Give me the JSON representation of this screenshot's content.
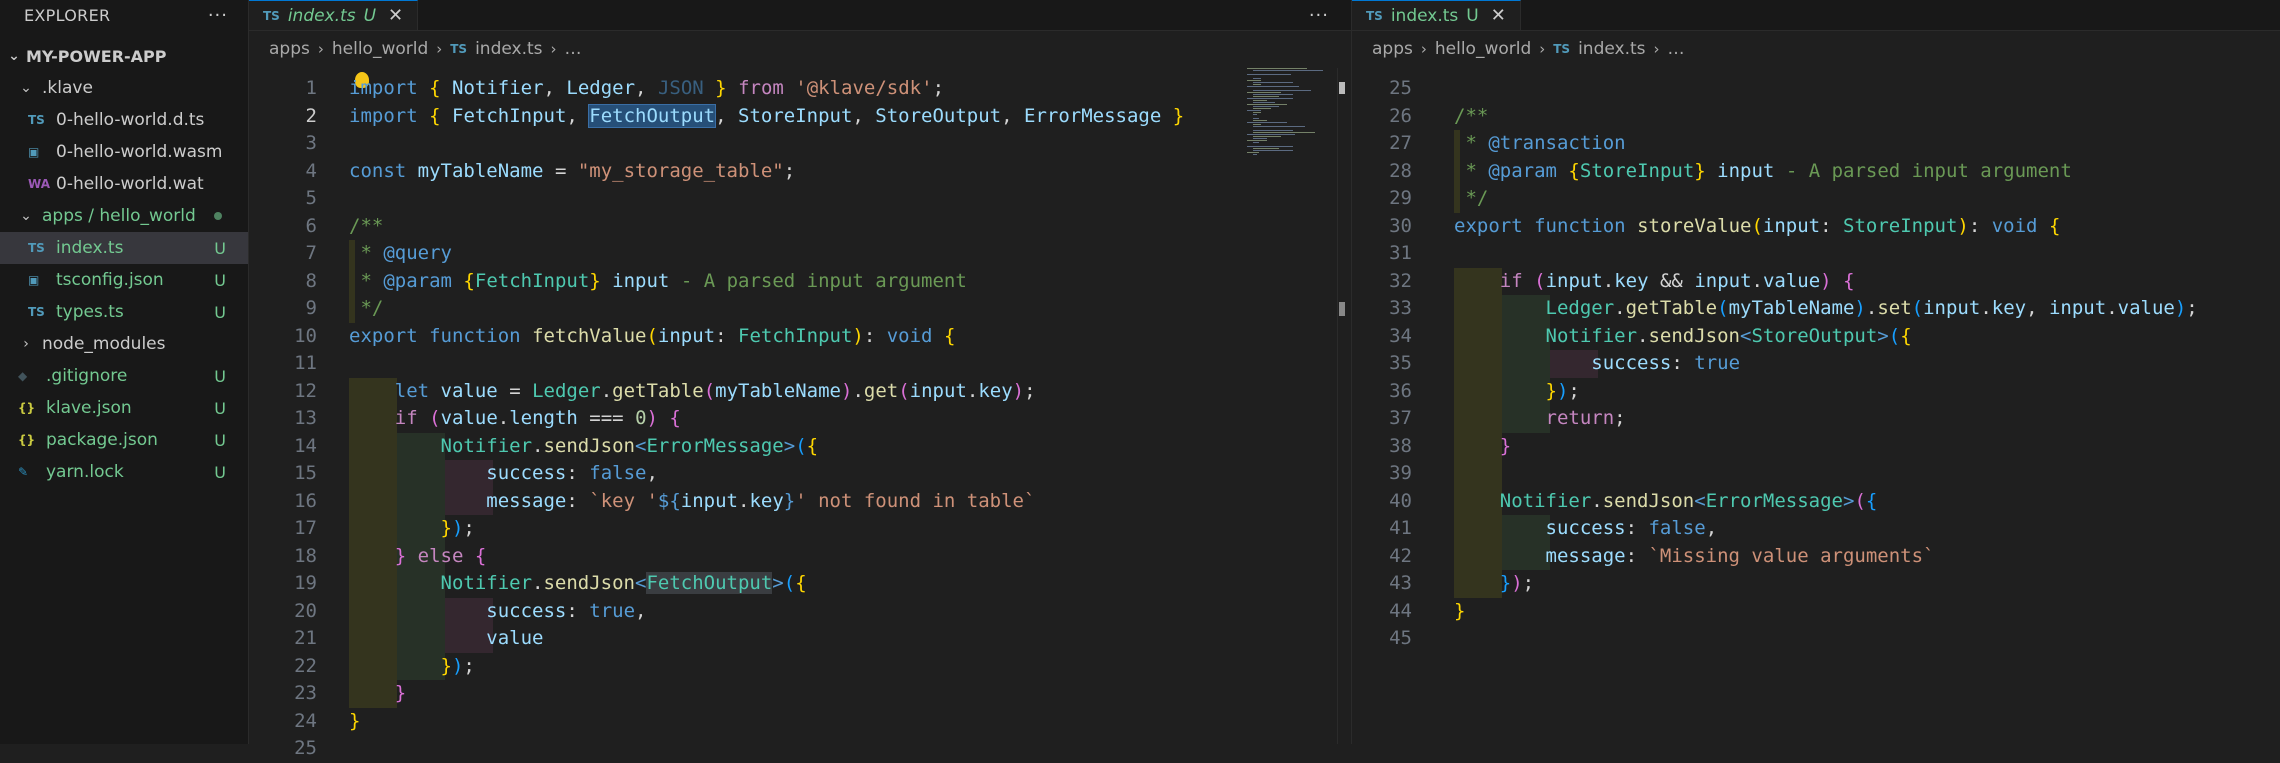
{
  "explorer": {
    "title": "EXPLORER",
    "more": "···",
    "root": "MY-POWER-APP",
    "items": [
      {
        "label": ".klave",
        "type": "folder",
        "indent": 1,
        "open": true,
        "icon": "",
        "status": ""
      },
      {
        "label": "0-hello-world.d.ts",
        "type": "file",
        "indent": 2,
        "icon": "TS",
        "status": ""
      },
      {
        "label": "0-hello-world.wasm",
        "type": "file",
        "indent": 2,
        "icon": "▣",
        "status": ""
      },
      {
        "label": "0-hello-world.wat",
        "type": "file",
        "indent": 2,
        "icon": "WA",
        "status": ""
      },
      {
        "label": "apps / hello_world",
        "type": "folder",
        "indent": 1,
        "open": true,
        "icon": "",
        "status": "dot"
      },
      {
        "label": "index.ts",
        "type": "file",
        "indent": 2,
        "icon": "TS",
        "status": "U",
        "active": true
      },
      {
        "label": "tsconfig.json",
        "type": "file",
        "indent": 2,
        "icon": "▣",
        "status": "U"
      },
      {
        "label": "types.ts",
        "type": "file",
        "indent": 2,
        "icon": "TS",
        "status": "U"
      },
      {
        "label": "node_modules",
        "type": "folder",
        "indent": 1,
        "open": false,
        "icon": "",
        "status": ""
      },
      {
        "label": ".gitignore",
        "type": "file",
        "indent": 1,
        "icon": "◆",
        "status": "U"
      },
      {
        "label": "klave.json",
        "type": "file",
        "indent": 1,
        "icon": "{}",
        "status": "U"
      },
      {
        "label": "package.json",
        "type": "file",
        "indent": 1,
        "icon": "{}",
        "status": "U"
      },
      {
        "label": "yarn.lock",
        "type": "file",
        "indent": 1,
        "icon": "✎",
        "status": "U"
      }
    ]
  },
  "left_editor": {
    "tab": {
      "icon": "TS",
      "label": "index.ts",
      "status": "U"
    },
    "more": "···",
    "breadcrumb": [
      "apps",
      "hello_world",
      "index.ts",
      "…"
    ],
    "current_line": 2
  },
  "right_editor": {
    "tab": {
      "icon": "TS",
      "label": "index.ts",
      "status": "U",
      "close": "✕"
    },
    "breadcrumb": [
      "apps",
      "hello_world",
      "index.ts",
      "…"
    ]
  },
  "colors": {
    "untracked": "#73c991",
    "ts_icon": "#519aba",
    "keyword": "#569cd6",
    "control": "#c586c0",
    "string": "#ce9178",
    "variable": "#9cdcfe",
    "function": "#dcdcaa",
    "type": "#4ec9b0",
    "comment": "#6a9955"
  },
  "left_code": [
    {
      "n": "1",
      "t": [
        [
          "kw",
          "import"
        ],
        [
          "pl",
          " "
        ],
        [
          "br1",
          "{"
        ],
        [
          "pl",
          " "
        ],
        [
          "var",
          "Notifier"
        ],
        [
          "pl",
          ", "
        ],
        [
          "var",
          "Ledger"
        ],
        [
          "pl",
          ", "
        ],
        [
          "fade",
          "JSON"
        ],
        [
          "pl",
          " "
        ],
        [
          "br1",
          "}"
        ],
        [
          "pl",
          " "
        ],
        [
          "ctl",
          "from"
        ],
        [
          "pl",
          " "
        ],
        [
          "str",
          "'@klave/sdk'"
        ],
        [
          "pl",
          ";"
        ]
      ]
    },
    {
      "n": "2",
      "t": [
        [
          "kw",
          "import"
        ],
        [
          "pl",
          " "
        ],
        [
          "br1",
          "{"
        ],
        [
          "pl",
          " "
        ],
        [
          "var",
          "FetchInput"
        ],
        [
          "pl",
          ", "
        ],
        [
          "var",
          "FetchOutput",
          "sel"
        ],
        [
          "pl",
          ", "
        ],
        [
          "var",
          "StoreInput"
        ],
        [
          "pl",
          ", "
        ],
        [
          "var",
          "StoreOutput"
        ],
        [
          "pl",
          ", "
        ],
        [
          "var",
          "ErrorMessage"
        ],
        [
          "pl",
          " "
        ],
        [
          "br1",
          "}"
        ]
      ]
    },
    {
      "n": "3",
      "t": []
    },
    {
      "n": "4",
      "t": [
        [
          "kw",
          "const"
        ],
        [
          "pl",
          " "
        ],
        [
          "var",
          "myTableName"
        ],
        [
          "pl",
          " = "
        ],
        [
          "str",
          "\"my_storage_table\""
        ],
        [
          "pl",
          ";"
        ]
      ]
    },
    {
      "n": "5",
      "t": []
    },
    {
      "n": "6",
      "t": [
        [
          "cm",
          "/**"
        ]
      ]
    },
    {
      "n": "7",
      "t": [
        [
          "cm",
          " * "
        ],
        [
          "kw",
          "@query"
        ]
      ]
    },
    {
      "n": "8",
      "t": [
        [
          "cm",
          " * "
        ],
        [
          "kw",
          "@param"
        ],
        [
          "cm",
          " "
        ],
        [
          "br1",
          "{"
        ],
        [
          "cls",
          "FetchInput"
        ],
        [
          "br1",
          "}"
        ],
        [
          "cm",
          " "
        ],
        [
          "var",
          "input"
        ],
        [
          "cm",
          " - A parsed input argument"
        ]
      ]
    },
    {
      "n": "9",
      "t": [
        [
          "cm",
          " */"
        ]
      ]
    },
    {
      "n": "10",
      "t": [
        [
          "kw",
          "export"
        ],
        [
          "pl",
          " "
        ],
        [
          "kw",
          "function"
        ],
        [
          "pl",
          " "
        ],
        [
          "fn",
          "fetchValue"
        ],
        [
          "br1",
          "("
        ],
        [
          "var",
          "input"
        ],
        [
          "pl",
          ": "
        ],
        [
          "cls",
          "FetchInput"
        ],
        [
          "br1",
          ")"
        ],
        [
          "pl",
          ": "
        ],
        [
          "kw",
          "void"
        ],
        [
          "pl",
          " "
        ],
        [
          "br1",
          "{"
        ]
      ]
    },
    {
      "n": "11",
      "t": []
    },
    {
      "n": "12",
      "t": [
        [
          "pl",
          "    "
        ],
        [
          "kw",
          "let"
        ],
        [
          "pl",
          " "
        ],
        [
          "var",
          "value"
        ],
        [
          "pl",
          " = "
        ],
        [
          "cls",
          "Ledger"
        ],
        [
          "pl",
          "."
        ],
        [
          "fn",
          "getTable"
        ],
        [
          "br2",
          "("
        ],
        [
          "var",
          "myTableName"
        ],
        [
          "br2",
          ")"
        ],
        [
          "pl",
          "."
        ],
        [
          "fn",
          "get"
        ],
        [
          "br2",
          "("
        ],
        [
          "var",
          "input"
        ],
        [
          "pl",
          "."
        ],
        [
          "var",
          "key"
        ],
        [
          "br2",
          ")"
        ],
        [
          "pl",
          ";"
        ]
      ]
    },
    {
      "n": "13",
      "t": [
        [
          "pl",
          "    "
        ],
        [
          "ctl",
          "if"
        ],
        [
          "pl",
          " "
        ],
        [
          "br2",
          "("
        ],
        [
          "var",
          "value"
        ],
        [
          "pl",
          "."
        ],
        [
          "var",
          "length"
        ],
        [
          "pl",
          " === "
        ],
        [
          "num",
          "0"
        ],
        [
          "br2",
          ")"
        ],
        [
          "pl",
          " "
        ],
        [
          "br2",
          "{"
        ]
      ]
    },
    {
      "n": "14",
      "t": [
        [
          "pl",
          "        "
        ],
        [
          "cls",
          "Notifier"
        ],
        [
          "pl",
          "."
        ],
        [
          "fn",
          "sendJson"
        ],
        [
          "tag",
          "<"
        ],
        [
          "cls",
          "ErrorMessage"
        ],
        [
          "tag",
          ">"
        ],
        [
          "br3",
          "("
        ],
        [
          "br1",
          "{"
        ]
      ]
    },
    {
      "n": "15",
      "t": [
        [
          "pl",
          "            "
        ],
        [
          "var",
          "success"
        ],
        [
          "pl",
          ": "
        ],
        [
          "kw",
          "false"
        ],
        [
          "pl",
          ","
        ]
      ]
    },
    {
      "n": "16",
      "t": [
        [
          "pl",
          "            "
        ],
        [
          "var",
          "message"
        ],
        [
          "pl",
          ": "
        ],
        [
          "str",
          "`key '"
        ],
        [
          "kw",
          "${"
        ],
        [
          "var",
          "input"
        ],
        [
          "pl",
          "."
        ],
        [
          "var",
          "key"
        ],
        [
          "kw",
          "}"
        ],
        [
          "str",
          "' not found in table`"
        ]
      ]
    },
    {
      "n": "17",
      "t": [
        [
          "pl",
          "        "
        ],
        [
          "br1",
          "}"
        ],
        [
          "br3",
          ")"
        ],
        [
          "pl",
          ";"
        ]
      ]
    },
    {
      "n": "18",
      "t": [
        [
          "pl",
          "    "
        ],
        [
          "br2",
          "}"
        ],
        [
          "pl",
          " "
        ],
        [
          "ctl",
          "else"
        ],
        [
          "pl",
          " "
        ],
        [
          "br2",
          "{"
        ]
      ]
    },
    {
      "n": "19",
      "t": [
        [
          "pl",
          "        "
        ],
        [
          "cls",
          "Notifier"
        ],
        [
          "pl",
          "."
        ],
        [
          "fn",
          "sendJson"
        ],
        [
          "tag",
          "<"
        ],
        [
          "cls",
          "FetchOutput",
          "gray"
        ],
        [
          "tag",
          ">"
        ],
        [
          "br3",
          "("
        ],
        [
          "br1",
          "{"
        ]
      ]
    },
    {
      "n": "20",
      "t": [
        [
          "pl",
          "            "
        ],
        [
          "var",
          "success"
        ],
        [
          "pl",
          ": "
        ],
        [
          "kw",
          "true"
        ],
        [
          "pl",
          ","
        ]
      ]
    },
    {
      "n": "21",
      "t": [
        [
          "pl",
          "            "
        ],
        [
          "var",
          "value"
        ]
      ]
    },
    {
      "n": "22",
      "t": [
        [
          "pl",
          "        "
        ],
        [
          "br1",
          "}"
        ],
        [
          "br3",
          ")"
        ],
        [
          "pl",
          ";"
        ]
      ]
    },
    {
      "n": "23",
      "t": [
        [
          "pl",
          "    "
        ],
        [
          "br2",
          "}"
        ]
      ]
    },
    {
      "n": "24",
      "t": [
        [
          "br1",
          "}"
        ]
      ]
    },
    {
      "n": "25",
      "t": []
    }
  ],
  "right_code": [
    {
      "n": "25",
      "t": []
    },
    {
      "n": "26",
      "t": [
        [
          "cm",
          "/**"
        ]
      ]
    },
    {
      "n": "27",
      "t": [
        [
          "cm",
          " * "
        ],
        [
          "kw",
          "@transaction"
        ]
      ]
    },
    {
      "n": "28",
      "t": [
        [
          "cm",
          " * "
        ],
        [
          "kw",
          "@param"
        ],
        [
          "cm",
          " "
        ],
        [
          "br1",
          "{"
        ],
        [
          "cls",
          "StoreInput"
        ],
        [
          "br1",
          "}"
        ],
        [
          "cm",
          " "
        ],
        [
          "var",
          "input"
        ],
        [
          "cm",
          " - A parsed input argument"
        ]
      ]
    },
    {
      "n": "29",
      "t": [
        [
          "cm",
          " */"
        ]
      ]
    },
    {
      "n": "30",
      "t": [
        [
          "kw",
          "export"
        ],
        [
          "pl",
          " "
        ],
        [
          "kw",
          "function"
        ],
        [
          "pl",
          " "
        ],
        [
          "fn",
          "storeValue"
        ],
        [
          "br1",
          "("
        ],
        [
          "var",
          "input"
        ],
        [
          "pl",
          ": "
        ],
        [
          "cls",
          "StoreInput"
        ],
        [
          "br1",
          ")"
        ],
        [
          "pl",
          ": "
        ],
        [
          "kw",
          "void"
        ],
        [
          "pl",
          " "
        ],
        [
          "br1",
          "{"
        ]
      ]
    },
    {
      "n": "31",
      "t": []
    },
    {
      "n": "32",
      "t": [
        [
          "pl",
          "    "
        ],
        [
          "ctl",
          "if"
        ],
        [
          "pl",
          " "
        ],
        [
          "br2",
          "("
        ],
        [
          "var",
          "input"
        ],
        [
          "pl",
          "."
        ],
        [
          "var",
          "key"
        ],
        [
          "pl",
          " && "
        ],
        [
          "var",
          "input"
        ],
        [
          "pl",
          "."
        ],
        [
          "var",
          "value"
        ],
        [
          "br2",
          ")"
        ],
        [
          "pl",
          " "
        ],
        [
          "br2",
          "{"
        ]
      ]
    },
    {
      "n": "33",
      "t": [
        [
          "pl",
          "        "
        ],
        [
          "cls",
          "Ledger"
        ],
        [
          "pl",
          "."
        ],
        [
          "fn",
          "getTable"
        ],
        [
          "br3",
          "("
        ],
        [
          "var",
          "myTableName"
        ],
        [
          "br3",
          ")"
        ],
        [
          "pl",
          "."
        ],
        [
          "fn",
          "set"
        ],
        [
          "br3",
          "("
        ],
        [
          "var",
          "input"
        ],
        [
          "pl",
          "."
        ],
        [
          "var",
          "key"
        ],
        [
          "pl",
          ", "
        ],
        [
          "var",
          "input"
        ],
        [
          "pl",
          "."
        ],
        [
          "var",
          "value"
        ],
        [
          "br3",
          ")"
        ],
        [
          "pl",
          ";"
        ]
      ]
    },
    {
      "n": "34",
      "t": [
        [
          "pl",
          "        "
        ],
        [
          "cls",
          "Notifier"
        ],
        [
          "pl",
          "."
        ],
        [
          "fn",
          "sendJson"
        ],
        [
          "tag",
          "<"
        ],
        [
          "cls",
          "StoreOutput"
        ],
        [
          "tag",
          ">"
        ],
        [
          "br3",
          "("
        ],
        [
          "br1",
          "{"
        ]
      ]
    },
    {
      "n": "35",
      "t": [
        [
          "pl",
          "            "
        ],
        [
          "var",
          "success"
        ],
        [
          "pl",
          ": "
        ],
        [
          "kw",
          "true"
        ]
      ]
    },
    {
      "n": "36",
      "t": [
        [
          "pl",
          "        "
        ],
        [
          "br1",
          "}"
        ],
        [
          "br3",
          ")"
        ],
        [
          "pl",
          ";"
        ]
      ]
    },
    {
      "n": "37",
      "t": [
        [
          "pl",
          "        "
        ],
        [
          "ctl",
          "return"
        ],
        [
          "pl",
          ";"
        ]
      ]
    },
    {
      "n": "38",
      "t": [
        [
          "pl",
          "    "
        ],
        [
          "br2",
          "}"
        ]
      ]
    },
    {
      "n": "39",
      "t": []
    },
    {
      "n": "40",
      "t": [
        [
          "pl",
          "    "
        ],
        [
          "cls",
          "Notifier"
        ],
        [
          "pl",
          "."
        ],
        [
          "fn",
          "sendJson"
        ],
        [
          "tag",
          "<"
        ],
        [
          "cls",
          "ErrorMessage"
        ],
        [
          "tag",
          ">"
        ],
        [
          "br2",
          "("
        ],
        [
          "br3",
          "{"
        ]
      ]
    },
    {
      "n": "41",
      "t": [
        [
          "pl",
          "        "
        ],
        [
          "var",
          "success"
        ],
        [
          "pl",
          ": "
        ],
        [
          "kw",
          "false"
        ],
        [
          "pl",
          ","
        ]
      ]
    },
    {
      "n": "42",
      "t": [
        [
          "pl",
          "        "
        ],
        [
          "var",
          "message"
        ],
        [
          "pl",
          ": "
        ],
        [
          "str",
          "`Missing value arguments`"
        ]
      ]
    },
    {
      "n": "43",
      "t": [
        [
          "pl",
          "    "
        ],
        [
          "br3",
          "}"
        ],
        [
          "br2",
          ")"
        ],
        [
          "pl",
          ";"
        ]
      ]
    },
    {
      "n": "44",
      "t": [
        [
          "br1",
          "}"
        ]
      ]
    },
    {
      "n": "45",
      "t": []
    }
  ]
}
